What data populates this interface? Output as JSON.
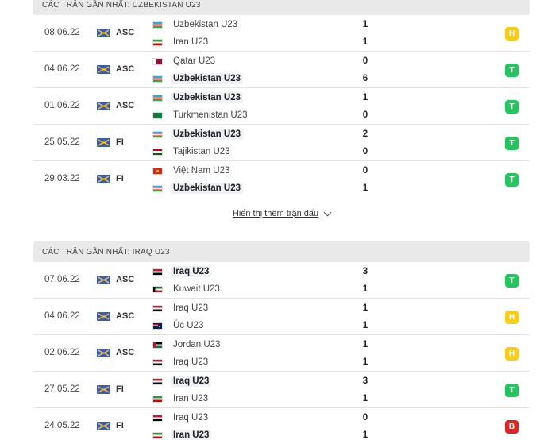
{
  "colors": {
    "win": "#22c55e",
    "draw": "#facc15",
    "loss": "#dc2626"
  },
  "sections": [
    {
      "title": "CÁC TRẬN GẦN NHẤT: UZBEKISTAN U23",
      "matches": [
        {
          "date": "08.06.22",
          "comp": "ASC",
          "home": {
            "name": "Uzbekistan U23",
            "flag": "uzb",
            "win": false
          },
          "away": {
            "name": "Iran U23",
            "flag": "irn",
            "win": false
          },
          "hs": "1",
          "as": "1",
          "result": "H",
          "rtype": "draw"
        },
        {
          "date": "04.06.22",
          "comp": "ASC",
          "home": {
            "name": "Qatar U23",
            "flag": "qat",
            "win": false
          },
          "away": {
            "name": "Uzbekistan U23",
            "flag": "uzb",
            "win": true
          },
          "hs": "0",
          "as": "6",
          "result": "T",
          "rtype": "win"
        },
        {
          "date": "01.06.22",
          "comp": "ASC",
          "home": {
            "name": "Uzbekistan U23",
            "flag": "uzb",
            "win": true
          },
          "away": {
            "name": "Turkmenistan U23",
            "flag": "tkm",
            "win": false
          },
          "hs": "1",
          "as": "0",
          "result": "T",
          "rtype": "win"
        },
        {
          "date": "25.05.22",
          "comp": "FI",
          "home": {
            "name": "Uzbekistan U23",
            "flag": "uzb",
            "win": true
          },
          "away": {
            "name": "Tajikistan U23",
            "flag": "tjk",
            "win": false
          },
          "hs": "2",
          "as": "0",
          "result": "T",
          "rtype": "win"
        },
        {
          "date": "29.03.22",
          "comp": "FI",
          "home": {
            "name": "Việt Nam U23",
            "flag": "vnm",
            "win": false
          },
          "away": {
            "name": "Uzbekistan U23",
            "flag": "uzb",
            "win": true
          },
          "hs": "0",
          "as": "1",
          "result": "T",
          "rtype": "win"
        }
      ],
      "more_label": "Hiển thị thêm trận đấu"
    },
    {
      "title": "CÁC TRẬN GẦN NHẤT: IRAQ U23",
      "matches": [
        {
          "date": "07.06.22",
          "comp": "ASC",
          "home": {
            "name": "Iraq U23",
            "flag": "irq",
            "win": true
          },
          "away": {
            "name": "Kuwait U23",
            "flag": "kwt",
            "win": false
          },
          "hs": "3",
          "as": "1",
          "result": "T",
          "rtype": "win"
        },
        {
          "date": "04.06.22",
          "comp": "ASC",
          "home": {
            "name": "Iraq U23",
            "flag": "irq",
            "win": false
          },
          "away": {
            "name": "Úc U23",
            "flag": "aus",
            "win": false
          },
          "hs": "1",
          "as": "1",
          "result": "H",
          "rtype": "draw"
        },
        {
          "date": "02.06.22",
          "comp": "ASC",
          "home": {
            "name": "Jordan U23",
            "flag": "jor",
            "win": false
          },
          "away": {
            "name": "Iraq U23",
            "flag": "irq",
            "win": false
          },
          "hs": "1",
          "as": "1",
          "result": "H",
          "rtype": "draw"
        },
        {
          "date": "27.05.22",
          "comp": "FI",
          "home": {
            "name": "Iraq U23",
            "flag": "irq",
            "win": true
          },
          "away": {
            "name": "Iran U23",
            "flag": "irn",
            "win": false
          },
          "hs": "3",
          "as": "1",
          "result": "T",
          "rtype": "win"
        },
        {
          "date": "24.05.22",
          "comp": "FI",
          "home": {
            "name": "Iraq U23",
            "flag": "irq",
            "win": false
          },
          "away": {
            "name": "Iran U23",
            "flag": "irn",
            "win": true
          },
          "hs": "0",
          "as": "1",
          "result": "B",
          "rtype": "loss"
        }
      ]
    }
  ]
}
